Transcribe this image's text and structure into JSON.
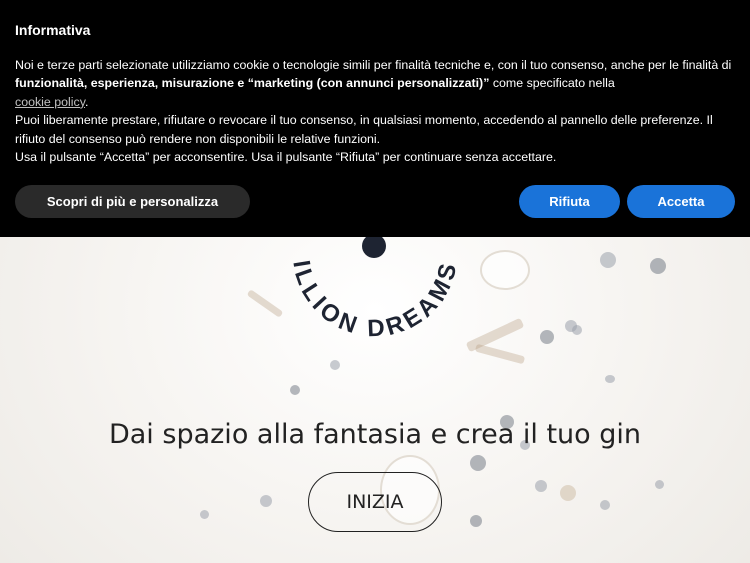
{
  "banner": {
    "title": "Informativa",
    "p1_a": "Noi e terze parti selezionate utilizziamo cookie o tecnologie simili per finalità tecniche e, con il tuo consenso, anche per le finalità di ",
    "p1_bold": "funzionalità, esperienza, misurazione e “marketing (con annunci personalizzati)”",
    "p1_b": " come specificato nella ",
    "cookie_link": "cookie policy",
    "p1_end": ".",
    "p2": "Puoi liberamente prestare, rifiutare o revocare il tuo consenso, in qualsiasi momento, accedendo al pannello delle preferenze. Il rifiuto del consenso può rendere non disponibili le relative funzioni.",
    "p3": "Usa il pulsante “Accetta” per acconsentire. Usa il pulsante “Rifiuta” per continuare senza accettare.",
    "more_label": "Scopri di più e personalizza",
    "reject_label": "Rifiuta",
    "accept_label": "Accetta"
  },
  "hero": {
    "logo_arc_text": "ILLION DREAMS",
    "tagline": "Dai spazio alla fantasia e crea il tuo gin",
    "cta_label": "INIZIA"
  },
  "colors": {
    "accent": "#1a73d9",
    "banner_bg": "#000000",
    "logo": "#1e2432"
  }
}
